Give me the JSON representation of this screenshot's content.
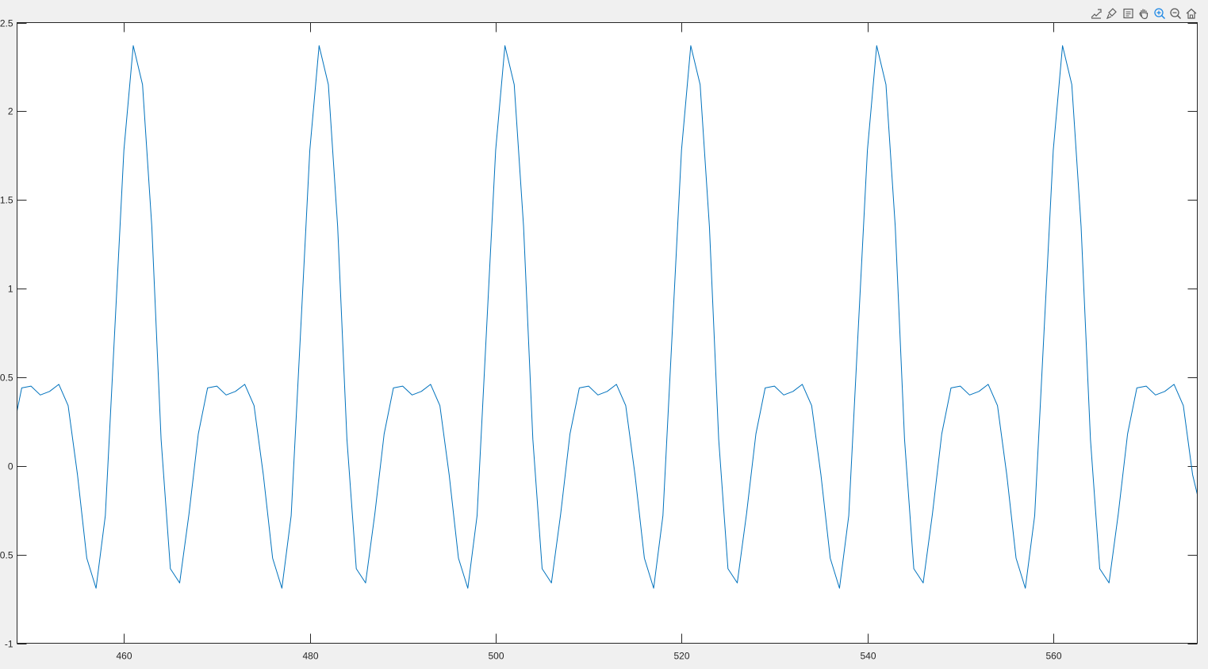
{
  "figure": {
    "toolbar": [
      {
        "name": "export-icon"
      },
      {
        "name": "brush-icon"
      },
      {
        "name": "datatip-icon"
      },
      {
        "name": "pan-hand-icon"
      },
      {
        "name": "zoom-in-icon"
      },
      {
        "name": "zoom-out-icon"
      },
      {
        "name": "home-icon"
      }
    ],
    "colors": {
      "background": "#f0f0f0",
      "axes_background": "#ffffff",
      "axes_edge": "#262626",
      "tick_text": "#262626",
      "series": "#0072bd",
      "toolbar_icon": "#5a5a5a",
      "toolbar_active": "#1e88e5"
    }
  },
  "chart_data": {
    "type": "line",
    "title": "",
    "xlabel": "",
    "ylabel": "",
    "xlim": [
      448.5,
      575.5
    ],
    "ylim": [
      -1,
      2.5
    ],
    "xticks": [
      460,
      480,
      500,
      520,
      540,
      560
    ],
    "yticks": [
      -1,
      -0.5,
      0,
      0.5,
      1,
      1.5,
      2,
      2.5
    ],
    "ytick_labels": [
      "-1",
      "-0.5",
      "0",
      "0.5",
      "1",
      "1.5",
      "2",
      "2.5"
    ],
    "grid": false,
    "legend": "none",
    "series": [
      {
        "x": [
          448.5,
          449,
          450,
          451,
          452,
          453,
          454,
          455,
          456,
          457,
          458,
          459,
          460,
          461,
          462,
          463,
          464,
          465,
          466,
          467,
          468,
          469,
          470,
          471,
          472,
          473,
          474,
          475,
          476,
          477,
          478,
          479,
          480,
          481,
          482,
          483,
          484,
          485,
          486,
          487,
          488,
          489,
          490,
          491,
          492,
          493,
          494,
          495,
          496,
          497,
          498,
          499,
          500,
          501,
          502,
          503,
          504,
          505,
          506,
          507,
          508,
          509,
          510,
          511,
          512,
          513,
          514,
          515,
          516,
          517,
          518,
          519,
          520,
          521,
          522,
          523,
          524,
          525,
          526,
          527,
          528,
          529,
          530,
          531,
          532,
          533,
          534,
          535,
          536,
          537,
          538,
          539,
          540,
          541,
          542,
          543,
          544,
          545,
          546,
          547,
          548,
          549,
          550,
          551,
          552,
          553,
          554,
          555,
          556,
          557,
          558,
          559,
          560,
          561,
          562,
          563,
          564,
          565,
          566,
          567,
          568,
          569,
          570,
          571,
          572,
          573,
          574,
          575,
          575.5
        ],
        "y": [
          0.31,
          0.44,
          0.45,
          0.4,
          0.42,
          0.46,
          0.34,
          -0.05,
          -0.52,
          -0.69,
          -0.28,
          0.75,
          1.78,
          2.37,
          2.15,
          1.35,
          0.15,
          -0.58,
          -0.66,
          -0.27,
          0.18,
          0.44,
          0.45,
          0.4,
          0.42,
          0.46,
          0.34,
          -0.05,
          -0.52,
          -0.69,
          -0.28,
          0.75,
          1.78,
          2.37,
          2.15,
          1.35,
          0.15,
          -0.58,
          -0.66,
          -0.27,
          0.18,
          0.44,
          0.45,
          0.4,
          0.42,
          0.46,
          0.34,
          -0.05,
          -0.52,
          -0.69,
          -0.28,
          0.75,
          1.78,
          2.37,
          2.15,
          1.35,
          0.15,
          -0.58,
          -0.66,
          -0.27,
          0.18,
          0.44,
          0.45,
          0.4,
          0.42,
          0.46,
          0.34,
          -0.05,
          -0.52,
          -0.69,
          -0.28,
          0.75,
          1.78,
          2.37,
          2.15,
          1.35,
          0.15,
          -0.58,
          -0.66,
          -0.27,
          0.18,
          0.44,
          0.45,
          0.4,
          0.42,
          0.46,
          0.34,
          -0.05,
          -0.52,
          -0.69,
          -0.28,
          0.75,
          1.78,
          2.37,
          2.15,
          1.35,
          0.15,
          -0.58,
          -0.66,
          -0.27,
          0.18,
          0.44,
          0.45,
          0.4,
          0.42,
          0.46,
          0.34,
          -0.05,
          -0.52,
          -0.69,
          -0.28,
          0.75,
          1.78,
          2.37,
          2.15,
          1.35,
          0.15,
          -0.58,
          -0.66,
          -0.27,
          0.18,
          0.44,
          0.45,
          0.4,
          0.42,
          0.46,
          0.34,
          -0.05,
          -0.16
        ]
      }
    ]
  }
}
